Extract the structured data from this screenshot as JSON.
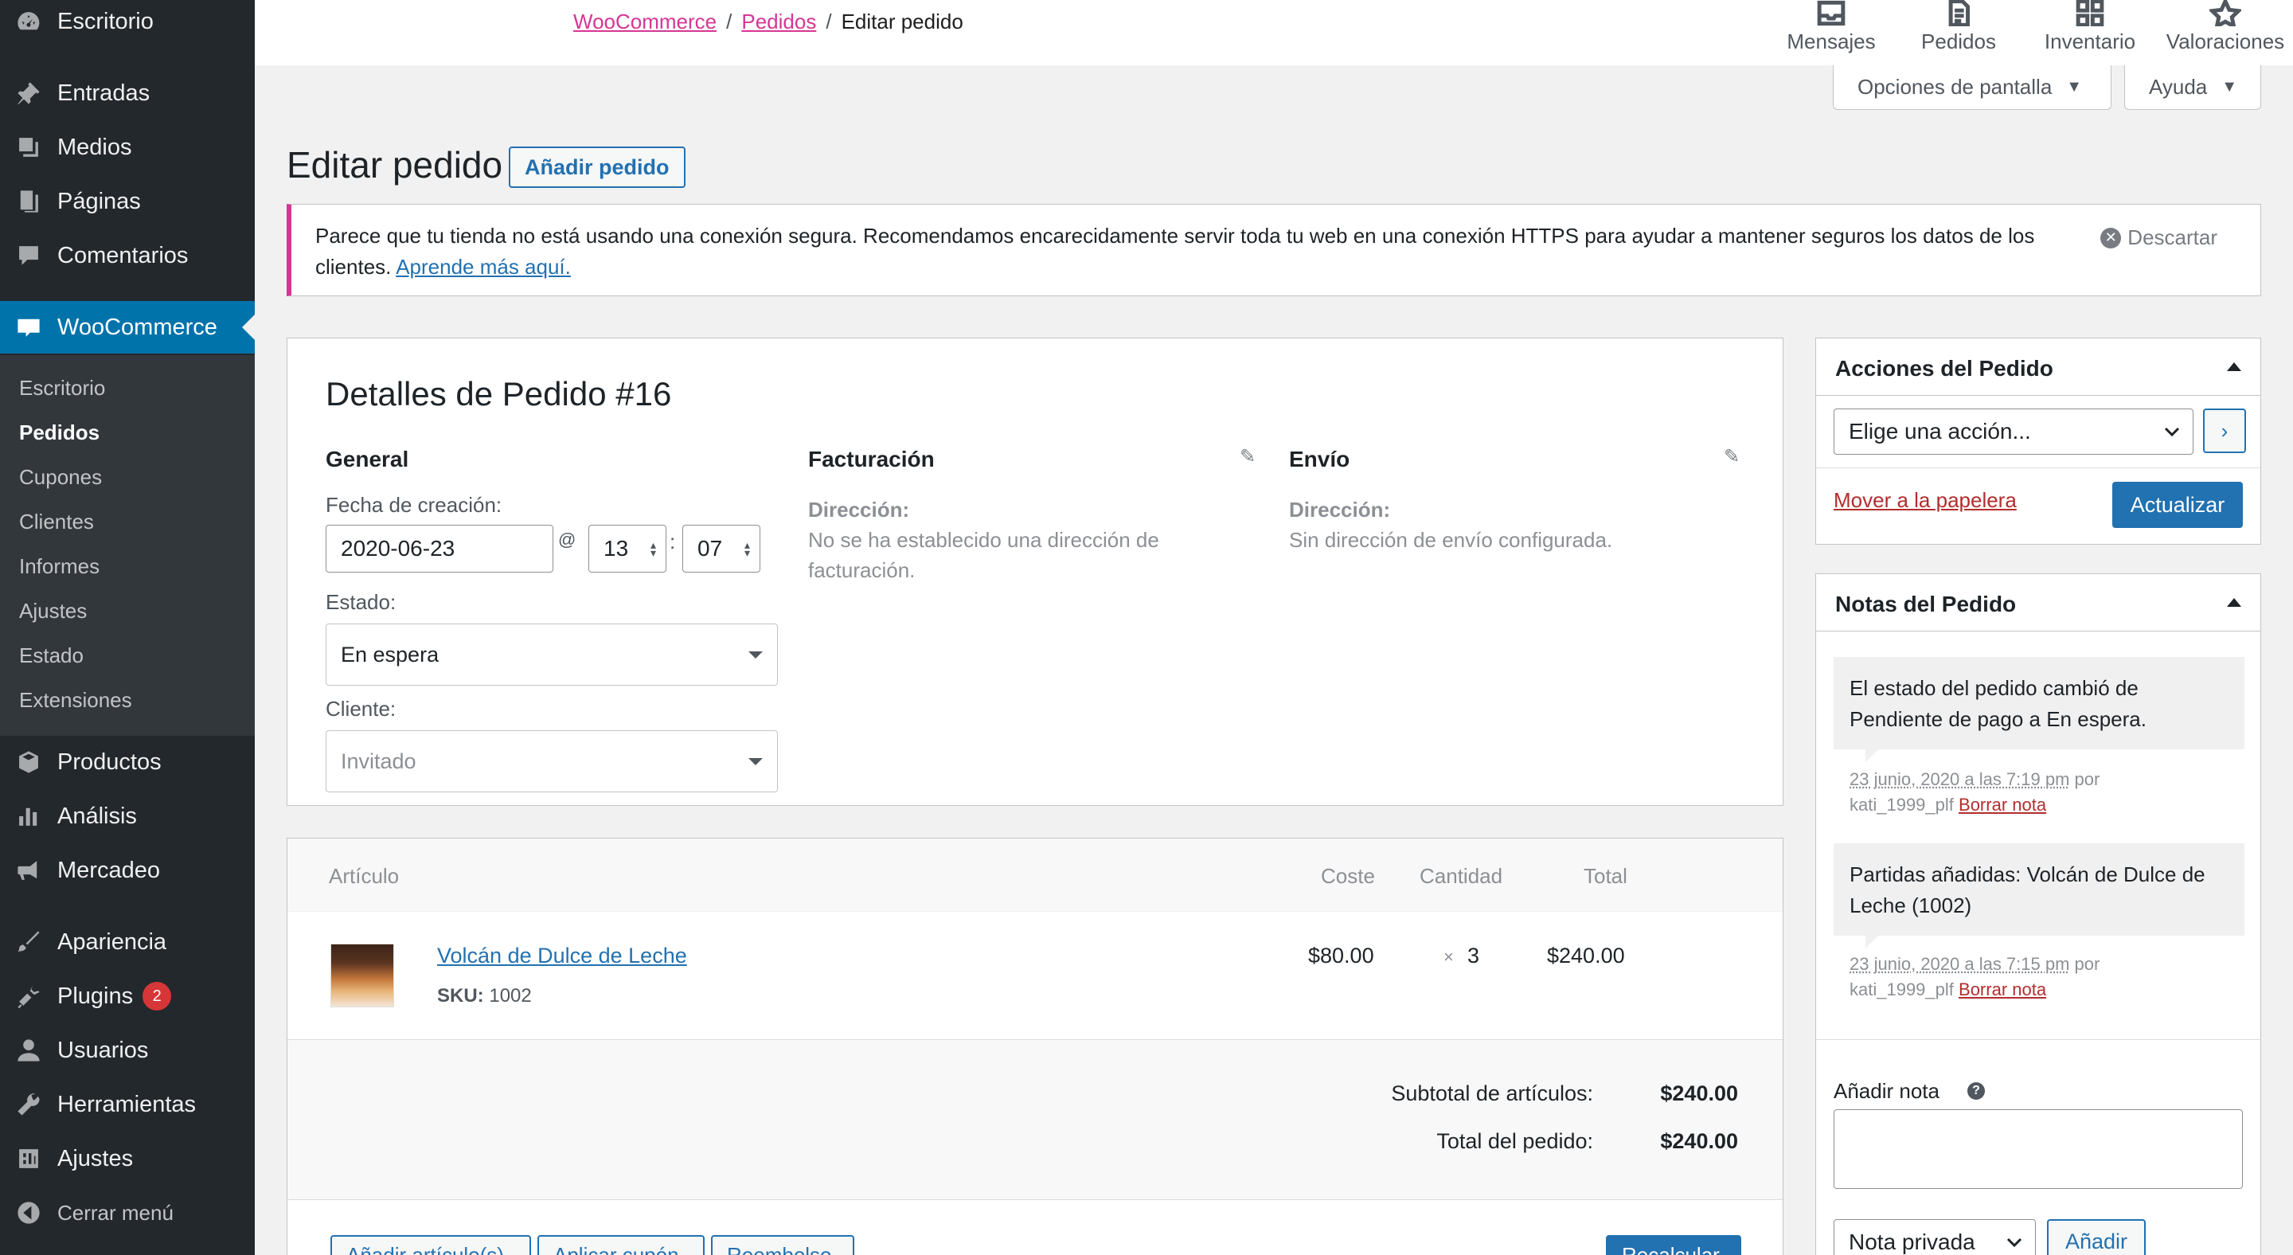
{
  "sidebar": {
    "items": [
      {
        "label": "Escritorio",
        "icon": "dashboard-icon"
      },
      {
        "label": "Entradas",
        "icon": "pin-icon"
      },
      {
        "label": "Medios",
        "icon": "media-icon"
      },
      {
        "label": "Páginas",
        "icon": "page-icon"
      },
      {
        "label": "Comentarios",
        "icon": "comment-icon"
      },
      {
        "label": "WooCommerce",
        "icon": "woocommerce-icon"
      },
      {
        "label": "Productos",
        "icon": "product-icon"
      },
      {
        "label": "Análisis",
        "icon": "analytics-icon"
      },
      {
        "label": "Mercadeo",
        "icon": "megaphone-icon"
      },
      {
        "label": "Apariencia",
        "icon": "brush-icon"
      },
      {
        "label": "Plugins",
        "icon": "plugin-icon",
        "badge": "2"
      },
      {
        "label": "Usuarios",
        "icon": "user-icon"
      },
      {
        "label": "Herramientas",
        "icon": "wrench-icon"
      },
      {
        "label": "Ajustes",
        "icon": "settings-icon"
      },
      {
        "label": "Cerrar menú",
        "icon": "collapse-icon"
      }
    ],
    "submenu": [
      "Escritorio",
      "Pedidos",
      "Cupones",
      "Clientes",
      "Informes",
      "Ajustes",
      "Estado",
      "Extensiones"
    ]
  },
  "breadcrumb": {
    "root": "WooCommerce",
    "parent": "Pedidos",
    "current": "Editar pedido"
  },
  "topbar": {
    "actions": [
      "Mensajes",
      "Pedidos",
      "Inventario",
      "Valoraciones"
    ],
    "screen_options": "Opciones de pantalla",
    "help": "Ayuda"
  },
  "page": {
    "title": "Editar pedido",
    "add_button": "Añadir pedido"
  },
  "notice": {
    "text": "Parece que tu tienda no está usando una conexión segura. Recomendamos encarecidamente servir toda tu web en una conexión HTTPS para ayudar a mantener seguros los datos de los clientes.",
    "link": "Aprende más aquí.",
    "dismiss": "Descartar"
  },
  "order": {
    "heading": "Detalles de Pedido #16",
    "general": {
      "title": "General",
      "date_label": "Fecha de creación:",
      "date": "2020-06-23",
      "at": "@",
      "hour": "13",
      "colon": ":",
      "minute": "07",
      "status_label": "Estado:",
      "status": "En espera",
      "customer_label": "Cliente:",
      "customer": "Invitado"
    },
    "billing": {
      "title": "Facturación",
      "address_label": "Dirección:",
      "address": "No se ha establecido una dirección de facturación."
    },
    "shipping": {
      "title": "Envío",
      "address_label": "Dirección:",
      "address": "Sin dirección de envío configurada."
    }
  },
  "items": {
    "headers": {
      "item": "Artículo",
      "cost": "Coste",
      "qty": "Cantidad",
      "total": "Total"
    },
    "rows": [
      {
        "name": "Volcán de Dulce de Leche",
        "sku_label": "SKU:",
        "sku": "1002",
        "cost": "$80.00",
        "times": "×",
        "qty": "3",
        "total": "$240.00"
      }
    ],
    "subtotal_label": "Subtotal de artículos:",
    "subtotal": "$240.00",
    "total_label": "Total del pedido:",
    "total": "$240.00",
    "footer_buttons": [
      "Añadir artículo(s)",
      "Aplicar cupón",
      "Reembolso",
      "Recalcular"
    ]
  },
  "actions_box": {
    "title": "Acciones del Pedido",
    "select": "Elige una acción...",
    "go": "›",
    "trash": "Mover a la papelera",
    "update": "Actualizar"
  },
  "notes_box": {
    "title": "Notas del Pedido",
    "notes": [
      {
        "text": "El estado del pedido cambió de Pendiente de pago a En espera.",
        "date": "23 junio, 2020 a las 7:19 pm",
        "by": "por",
        "author": "kati_1999_plf",
        "delete": "Borrar nota"
      },
      {
        "text": "Partidas añadidas: Volcán de Dulce de Leche (1002)",
        "date": "23 junio, 2020 a las 7:15 pm",
        "by": "por",
        "author": "kati_1999_plf",
        "delete": "Borrar nota"
      }
    ],
    "add_label": "Añadir nota",
    "help": "?",
    "note_type": "Nota privada",
    "add_button": "Añadir"
  },
  "colors": {
    "sidebar": "#23282d",
    "accent": "#0073aa",
    "woo_pink": "#d63694",
    "badge": "#d63638"
  }
}
